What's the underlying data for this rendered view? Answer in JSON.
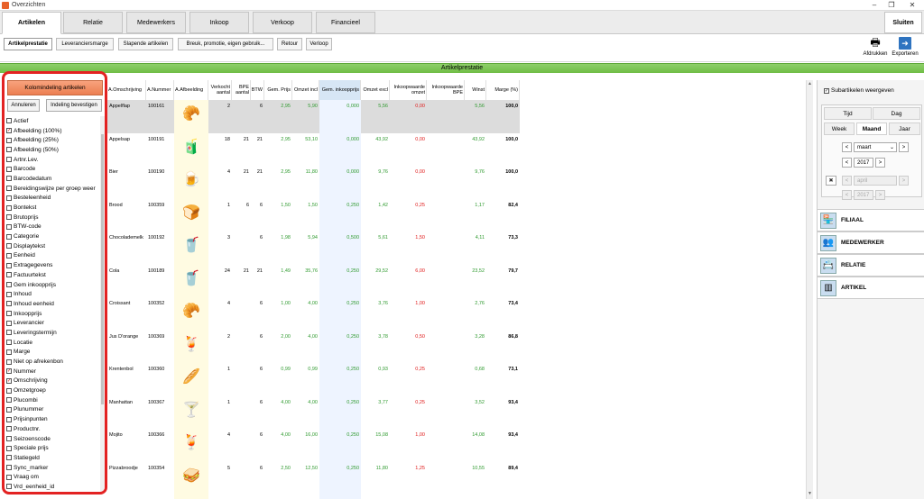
{
  "window": {
    "title": "Overzichten"
  },
  "main_tabs": [
    {
      "label": "Artikelen"
    },
    {
      "label": "Relatie"
    },
    {
      "label": "Medewerkers"
    },
    {
      "label": "Inkoop"
    },
    {
      "label": "Verkoop"
    },
    {
      "label": "Financieel"
    }
  ],
  "close_label": "Sluiten",
  "sub_tabs": [
    {
      "label": "Artikelprestatie"
    },
    {
      "label": "Leveranciersmarge"
    },
    {
      "label": "Slapende artikelen"
    },
    {
      "label": "Breuk, promotie, eigen gebruik..."
    },
    {
      "label": "Retour"
    },
    {
      "label": "Verloop"
    }
  ],
  "toolbar": {
    "print_label": "Afdrukken",
    "export_label": "Exporteren"
  },
  "section_title": "Artikelprestatie",
  "left_panel": {
    "button_label": "Kolomindeling artikelen",
    "cancel_label": "Annuleren",
    "confirm_label": "Indeling bevestigen",
    "columns": [
      {
        "label": "Actief",
        "checked": ""
      },
      {
        "label": "Afbeelding (100%)",
        "checked": "✓"
      },
      {
        "label": "Afbeelding (25%)",
        "checked": ""
      },
      {
        "label": "Afbeelding (50%)",
        "checked": ""
      },
      {
        "label": "Artnr.Lev.",
        "checked": ""
      },
      {
        "label": "Barcode",
        "checked": ""
      },
      {
        "label": "Barcodedatum",
        "checked": ""
      },
      {
        "label": "Bereidingswijze per groep weer",
        "checked": ""
      },
      {
        "label": "Besteleenheid",
        "checked": ""
      },
      {
        "label": "Bontekst",
        "checked": ""
      },
      {
        "label": "Brutoprijs",
        "checked": ""
      },
      {
        "label": "BTW-code",
        "checked": ""
      },
      {
        "label": "Categorie",
        "checked": ""
      },
      {
        "label": "Displaytekst",
        "checked": ""
      },
      {
        "label": "Eenheid",
        "checked": ""
      },
      {
        "label": "Extragegevens",
        "checked": ""
      },
      {
        "label": "Factuurtekst",
        "checked": ""
      },
      {
        "label": "Gem inkoopprijs",
        "checked": ""
      },
      {
        "label": "Inhoud",
        "checked": ""
      },
      {
        "label": "Inhoud eenheid",
        "checked": ""
      },
      {
        "label": "Inkoopprijs",
        "checked": ""
      },
      {
        "label": "Leverancier",
        "checked": ""
      },
      {
        "label": "Leveringstermijn",
        "checked": ""
      },
      {
        "label": "Locatie",
        "checked": ""
      },
      {
        "label": "Marge",
        "checked": ""
      },
      {
        "label": "Niet op afrekenbon",
        "checked": ""
      },
      {
        "label": "Nummer",
        "checked": "✓"
      },
      {
        "label": "Omschrijving",
        "checked": "✓"
      },
      {
        "label": "Omzetgroep",
        "checked": ""
      },
      {
        "label": "Plucombi",
        "checked": ""
      },
      {
        "label": "Plunummer",
        "checked": ""
      },
      {
        "label": "Prijsinpunten",
        "checked": ""
      },
      {
        "label": "Productnr.",
        "checked": ""
      },
      {
        "label": "Seizoenscode",
        "checked": ""
      },
      {
        "label": "Speciale prijs",
        "checked": ""
      },
      {
        "label": "Statiegeld",
        "checked": ""
      },
      {
        "label": "Sync_marker",
        "checked": ""
      },
      {
        "label": "Vraag om",
        "checked": ""
      },
      {
        "label": "Vrd_eenheid_id",
        "checked": ""
      }
    ]
  },
  "table": {
    "headers": [
      "A.Omschrijving",
      "A.Nummer",
      "A.Afbeelding",
      "Verkocht aantal",
      "BPE aantal",
      "BTW",
      "Gem. Prijs",
      "Omzet incl",
      "Gem. inkoopprijs",
      "Omzet excl",
      "Inkoopwaarde omzet",
      "Inkoopwaarde BPE",
      "Winst",
      "Marge (%)"
    ],
    "rows": [
      {
        "name": "Appelflap",
        "nr": "100161",
        "icon": "🥐",
        "verkocht": "2",
        "bpe": "",
        "btw": "6",
        "prijs": "2,95",
        "omzet_incl": "5,90",
        "gem_inkoop": "0,000",
        "omzet_excl": "5,56",
        "ink_omzet": "0,00",
        "ink_bpe": "",
        "winst": "5,56",
        "marge": "100,0"
      },
      {
        "name": "Appelsap",
        "nr": "100191",
        "icon": "🧃",
        "verkocht": "18",
        "bpe": "21",
        "btw": "21",
        "prijs": "2,95",
        "omzet_incl": "53,10",
        "gem_inkoop": "0,000",
        "omzet_excl": "43,92",
        "ink_omzet": "0,00",
        "ink_bpe": "",
        "winst": "43,92",
        "marge": "100,0"
      },
      {
        "name": "Bier",
        "nr": "100190",
        "icon": "🍺",
        "verkocht": "4",
        "bpe": "21",
        "btw": "21",
        "prijs": "2,95",
        "omzet_incl": "11,80",
        "gem_inkoop": "0,000",
        "omzet_excl": "9,76",
        "ink_omzet": "0,00",
        "ink_bpe": "",
        "winst": "9,76",
        "marge": "100,0"
      },
      {
        "name": "Brood",
        "nr": "100359",
        "icon": "🍞",
        "verkocht": "1",
        "bpe": "6",
        "btw": "6",
        "prijs": "1,50",
        "omzet_incl": "1,50",
        "gem_inkoop": "0,250",
        "omzet_excl": "1,42",
        "ink_omzet": "0,25",
        "ink_bpe": "",
        "winst": "1,17",
        "marge": "82,4"
      },
      {
        "name": "Chocolademelk",
        "nr": "100192",
        "icon": "🥤",
        "verkocht": "3",
        "bpe": "",
        "btw": "6",
        "prijs": "1,98",
        "omzet_incl": "5,94",
        "gem_inkoop": "0,500",
        "omzet_excl": "5,61",
        "ink_omzet": "1,50",
        "ink_bpe": "",
        "winst": "4,11",
        "marge": "73,3"
      },
      {
        "name": "Cola",
        "nr": "100189",
        "icon": "🥤",
        "verkocht": "24",
        "bpe": "21",
        "btw": "21",
        "prijs": "1,49",
        "omzet_incl": "35,76",
        "gem_inkoop": "0,250",
        "omzet_excl": "29,52",
        "ink_omzet": "6,00",
        "ink_bpe": "",
        "winst": "23,52",
        "marge": "79,7"
      },
      {
        "name": "Croissant",
        "nr": "100352",
        "icon": "🥐",
        "verkocht": "4",
        "bpe": "",
        "btw": "6",
        "prijs": "1,00",
        "omzet_incl": "4,00",
        "gem_inkoop": "0,250",
        "omzet_excl": "3,76",
        "ink_omzet": "1,00",
        "ink_bpe": "",
        "winst": "2,76",
        "marge": "73,4"
      },
      {
        "name": "Jus D'orange",
        "nr": "100369",
        "icon": "🍹",
        "verkocht": "2",
        "bpe": "",
        "btw": "6",
        "prijs": "2,00",
        "omzet_incl": "4,00",
        "gem_inkoop": "0,250",
        "omzet_excl": "3,78",
        "ink_omzet": "0,50",
        "ink_bpe": "",
        "winst": "3,28",
        "marge": "86,8"
      },
      {
        "name": "Krentenbol",
        "nr": "100360",
        "icon": "🥖",
        "verkocht": "1",
        "bpe": "",
        "btw": "6",
        "prijs": "0,99",
        "omzet_incl": "0,99",
        "gem_inkoop": "0,250",
        "omzet_excl": "0,93",
        "ink_omzet": "0,25",
        "ink_bpe": "",
        "winst": "0,68",
        "marge": "73,1"
      },
      {
        "name": "Manhattan",
        "nr": "100367",
        "icon": "🍸",
        "verkocht": "1",
        "bpe": "",
        "btw": "6",
        "prijs": "4,00",
        "omzet_incl": "4,00",
        "gem_inkoop": "0,250",
        "omzet_excl": "3,77",
        "ink_omzet": "0,25",
        "ink_bpe": "",
        "winst": "3,52",
        "marge": "93,4"
      },
      {
        "name": "Mojito",
        "nr": "100366",
        "icon": "🍹",
        "verkocht": "4",
        "bpe": "",
        "btw": "6",
        "prijs": "4,00",
        "omzet_incl": "16,00",
        "gem_inkoop": "0,250",
        "omzet_excl": "15,08",
        "ink_omzet": "1,00",
        "ink_bpe": "",
        "winst": "14,08",
        "marge": "93,4"
      },
      {
        "name": "Pizzabroodje",
        "nr": "100354",
        "icon": "🥪",
        "verkocht": "5",
        "bpe": "",
        "btw": "6",
        "prijs": "2,50",
        "omzet_incl": "12,50",
        "gem_inkoop": "0,250",
        "omzet_excl": "11,80",
        "ink_omzet": "1,25",
        "ink_bpe": "",
        "winst": "10,55",
        "marge": "89,4"
      }
    ]
  },
  "right_panel": {
    "subarticles_label": "Subartikelen weergeven",
    "tabs_top": [
      "Tijd",
      "Dag"
    ],
    "tabs_bottom": [
      "Week",
      "Maand",
      "Jaar"
    ],
    "month_from": "maart",
    "year_from": "2017",
    "month_to": "april",
    "year_to": "2017",
    "groups": [
      "FILIAAL",
      "MEDEWERKER",
      "RELATIE",
      "ARTIKEL"
    ]
  }
}
